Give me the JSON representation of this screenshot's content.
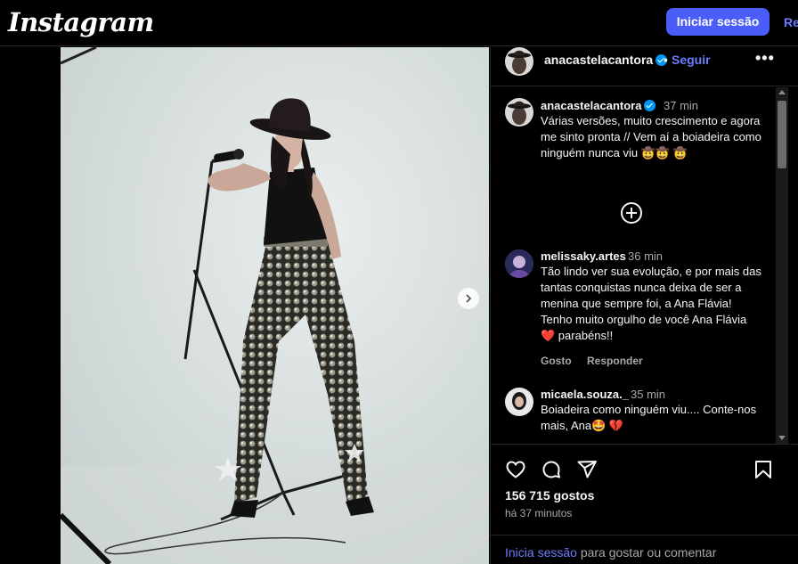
{
  "topbar": {
    "logo": "Instagram",
    "login_label": "Iniciar sessão",
    "register_label": "Registar"
  },
  "post": {
    "username": "anacastelacantora",
    "follow_label": "Seguir",
    "dot": "•",
    "more": "•••",
    "caption": {
      "username": "anacastelacantora",
      "time": "37 min",
      "text": "Várias versões, muito crescimento e agora me sinto pronta // Vem aí a boiadeira como ninguém nunca viu 🤠🤠 🤠"
    },
    "comments": [
      {
        "username": "melissaky.artes",
        "time": "36 min",
        "text": "Tão lindo ver sua evolução, e por mais das tantas conquistas nunca deixa de ser a menina que sempre foi, a Ana Flávia! Tenho muito orgulho de você Ana Flávia ❤️ parabéns!!",
        "like_label": "Gosto",
        "reply_label": "Responder"
      },
      {
        "username": "micaela.souza._",
        "time": "35 min",
        "text": "Boiadeira como ninguém viu.... Conte-nos mais, Ana🤩 💔"
      }
    ],
    "likes": "156 715 gostos",
    "ago": "há 37 minutos",
    "footer_link": "Inicia sessão",
    "footer_rest": " para gostar ou comentar"
  },
  "icons": {
    "like": "heart-icon",
    "comment": "comment-icon",
    "share": "send-icon",
    "save": "bookmark-icon",
    "next": "chevron-right-icon",
    "load_more": "plus-circle-icon"
  },
  "colors": {
    "accent": "#4a5df9",
    "link": "#6b7cff",
    "verified": "#0095f6",
    "muted": "#a8a8a8"
  }
}
